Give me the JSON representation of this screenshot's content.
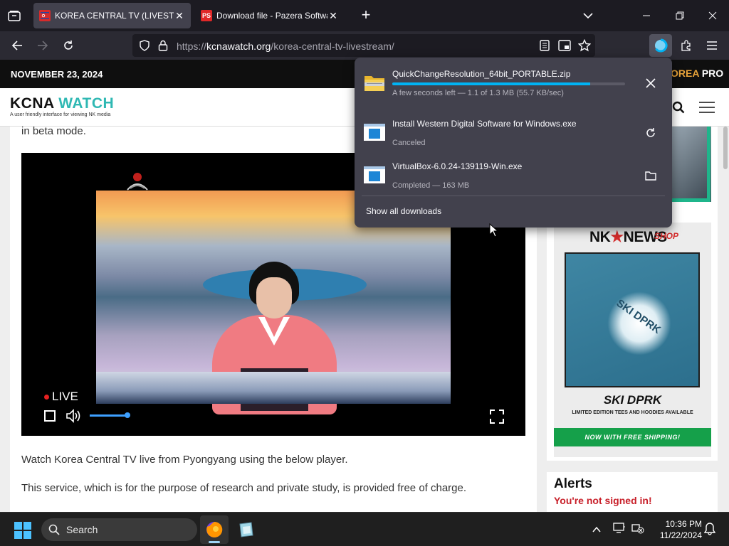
{
  "browser": {
    "tabs": [
      {
        "title": "KOREA CENTRAL TV (LIVESTRE",
        "favicon": "kcna-flag-icon",
        "active": true
      },
      {
        "title": "Download file - Pazera Software",
        "favicon": "pazera-ps-icon",
        "active": false
      }
    ],
    "url_prefix": "https://",
    "url_host": "kcnawatch.org",
    "url_path": "/korea-central-tv-livestream/"
  },
  "page": {
    "date": "NOVEMBER 23, 2024",
    "nk_pro_suffix": "OREA",
    "nk_pro": "PRO",
    "logo_main": "KCNA",
    "logo_accent": "WATCH",
    "logo_tagline": "A user friendly interface for viewing NK media",
    "beta_text": "in beta mode.",
    "live_label": "LIVE",
    "volume_level": 0.85,
    "paragraph1": "Watch Korea Central TV live from Pyongyang using the below player.",
    "paragraph2": "This service, which is for the purpose of research and private study, is provided free of charge."
  },
  "sidebar": {
    "ad_brand_left": "NK",
    "ad_brand_star": "★",
    "ad_brand_right": "NEWS",
    "ad_shop": "SHOP",
    "ad_print": "SKI DPRK",
    "ad_title": "SKI DPRK",
    "ad_subtitle": "LIMITED EDITION TEES AND HOODIES AVAILABLE",
    "ad_cta": "NOW WITH FREE SHIPPING!",
    "alerts_heading": "Alerts",
    "alerts_status": "You're not signed in!"
  },
  "downloads": {
    "items": [
      {
        "name": "QuickChangeResolution_64bit_PORTABLE.zip",
        "status": "A few seconds left — 1.1 of 1.3 MB (55.7 KB/sec)",
        "progress": 0.85,
        "action": "cancel"
      },
      {
        "name": "Install Western Digital Software for Windows.exe",
        "status": "Canceled",
        "action": "retry"
      },
      {
        "name": "VirtualBox-6.0.24-139119-Win.exe",
        "status": "Completed — 163 MB",
        "action": "open-folder"
      }
    ],
    "show_all": "Show all downloads"
  },
  "taskbar": {
    "search_label": "Search",
    "time": "10:36 PM",
    "date": "11/22/2024"
  },
  "colors": {
    "accent": "#00b3f4",
    "logo_teal": "#2fb8b3",
    "alert_red": "#c8202a",
    "ad_green": "#15a04a"
  }
}
